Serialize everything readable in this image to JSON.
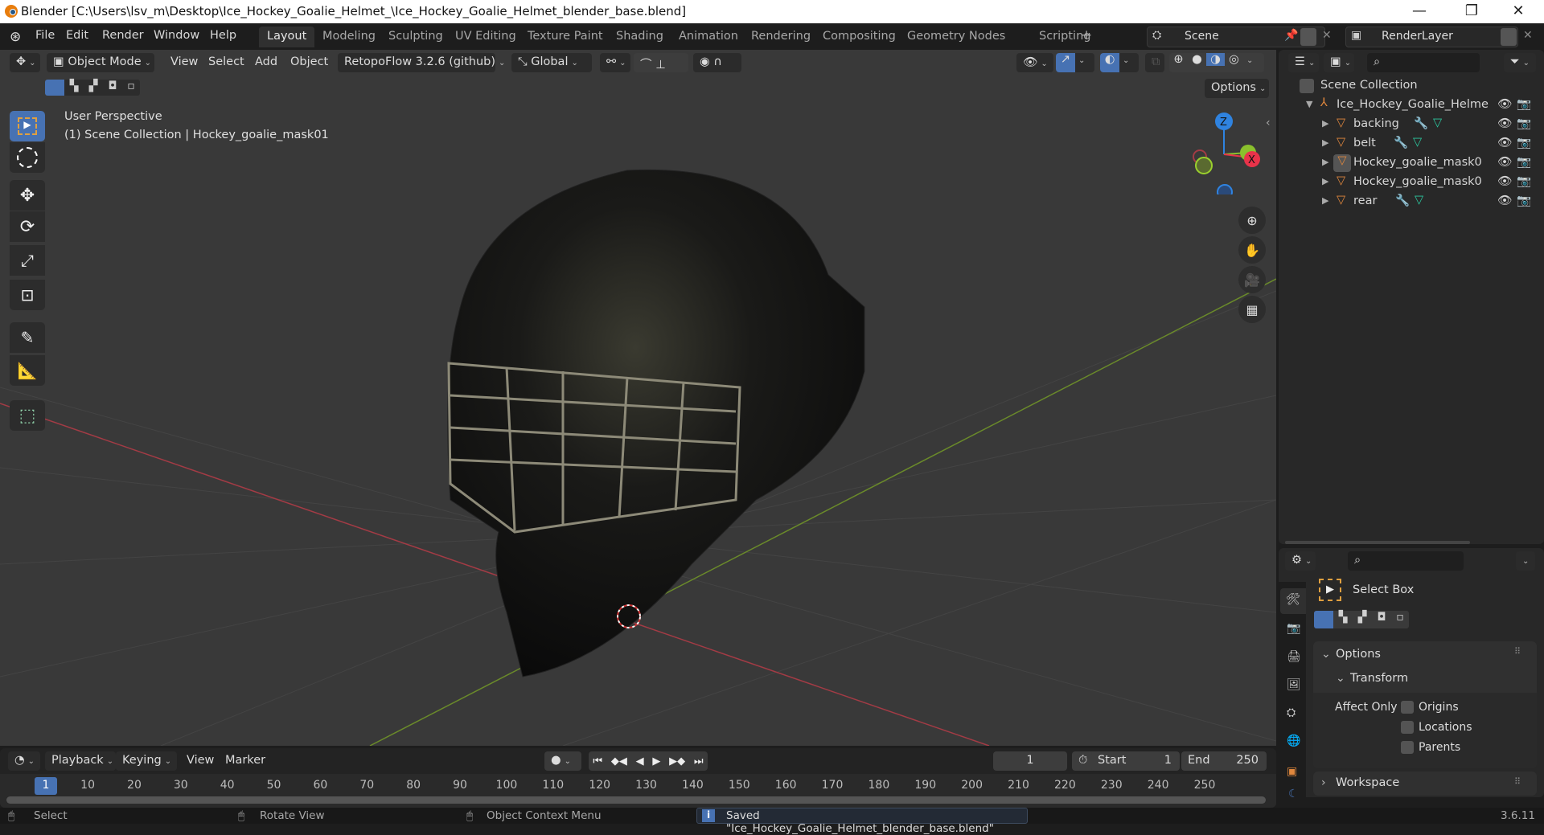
{
  "window": {
    "title": "Blender [C:\\Users\\lsv_m\\Desktop\\Ice_Hockey_Goalie_Helmet_\\Ice_Hockey_Goalie_Helmet_blender_base.blend]",
    "controls": {
      "minimize": "—",
      "maximize": "❐",
      "close": "✕"
    }
  },
  "menubar": {
    "menus": [
      "File",
      "Edit",
      "Render",
      "Window",
      "Help"
    ],
    "workspace_tabs": [
      "Layout",
      "Modeling",
      "Sculpting",
      "UV Editing",
      "Texture Paint",
      "Shading",
      "Animation",
      "Rendering",
      "Compositing",
      "Geometry Nodes",
      "Scripting"
    ],
    "active_tab": "Layout",
    "add_tab": "+",
    "scene": "Scene",
    "view_layer": "RenderLayer"
  },
  "viewport": {
    "mode": "Object Mode",
    "menus": [
      "View",
      "Select",
      "Add",
      "Object"
    ],
    "addon_menu": "RetopoFlow 3.2.6 (github)",
    "orientation": "Global",
    "options_label": "Options",
    "overlay_title": "User Perspective",
    "overlay_subtitle": "(1) Scene Collection | Hockey_goalie_mask01",
    "gizmo_axes": {
      "x": "X",
      "y": "Y",
      "z": "Z"
    },
    "colors": {
      "accent": "#4772b3",
      "x_axis": "#e8334a",
      "y_axis": "#8ac02d",
      "z_axis": "#2f83e0"
    }
  },
  "tools": [
    "select-box",
    "cursor",
    "move",
    "rotate",
    "scale",
    "transform",
    "annotate",
    "measure",
    "add-cube"
  ],
  "outliner": {
    "root": "Scene Collection",
    "collection": "Ice_Hockey_Goalie_Helme",
    "items": [
      {
        "name": "backing",
        "has_modifier": true
      },
      {
        "name": "belt",
        "has_modifier": true
      },
      {
        "name": "Hockey_goalie_mask0",
        "has_modifier": false,
        "active": true
      },
      {
        "name": "Hockey_goalie_mask0",
        "has_modifier": false
      },
      {
        "name": "rear",
        "has_modifier": true
      }
    ]
  },
  "properties": {
    "tool_name": "Select Box",
    "options_label": "Options",
    "transform_label": "Transform",
    "affect_only_label": "Affect Only",
    "checkboxes": [
      {
        "label": "Origins",
        "checked": false
      },
      {
        "label": "Locations",
        "checked": false
      },
      {
        "label": "Parents",
        "checked": false
      }
    ],
    "workspace_label": "Workspace"
  },
  "timeline": {
    "menus": [
      "Playback",
      "Keying",
      "View",
      "Marker"
    ],
    "current_frame": "1",
    "start_label": "Start",
    "start": "1",
    "end_label": "End",
    "end": "250",
    "ticks": [
      "1",
      "10",
      "20",
      "30",
      "40",
      "50",
      "60",
      "70",
      "80",
      "90",
      "100",
      "110",
      "120",
      "130",
      "140",
      "150",
      "160",
      "170",
      "180",
      "190",
      "200",
      "210",
      "220",
      "230",
      "240",
      "250"
    ]
  },
  "statusbar": {
    "select": "Select",
    "rotate": "Rotate View",
    "context": "Object Context Menu",
    "message": "Saved \"Ice_Hockey_Goalie_Helmet_blender_base.blend\"",
    "version": "3.6.11"
  }
}
